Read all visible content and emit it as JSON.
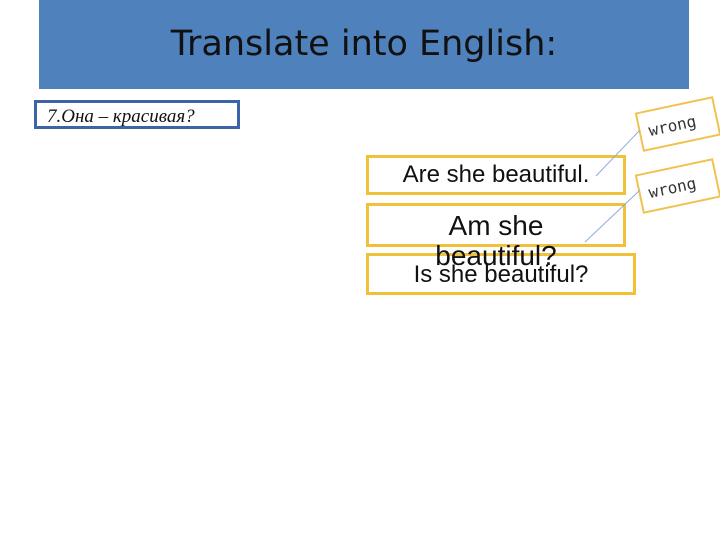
{
  "slide": {
    "title": "Translate into English:",
    "question": "7.Она – красивая?"
  },
  "answers": [
    {
      "text": "Are she beautiful.",
      "status": "wrong"
    },
    {
      "text_line1": "Am she",
      "text_line2": "beautiful?",
      "status": "wrong"
    },
    {
      "text": "Is she beautiful?",
      "status": "correct"
    }
  ],
  "tags": [
    {
      "label": "wrong"
    },
    {
      "label": "wrong"
    }
  ],
  "colors": {
    "title_bar": "#4f81bd",
    "question_border": "#3e64a8",
    "answer_border": "#f0c23a"
  }
}
